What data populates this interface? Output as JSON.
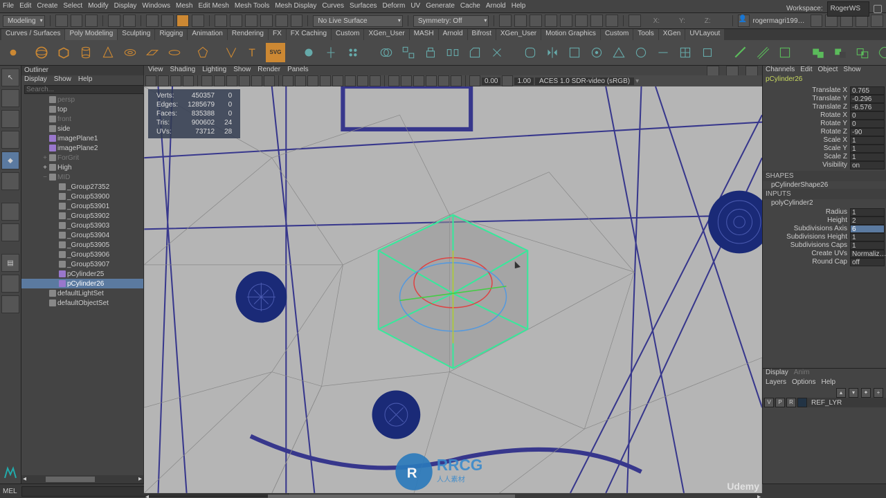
{
  "menu": [
    "File",
    "Edit",
    "Create",
    "Select",
    "Modify",
    "Display",
    "Windows",
    "Mesh",
    "Edit Mesh",
    "Mesh Tools",
    "Mesh Display",
    "Curves",
    "Surfaces",
    "Deform",
    "UV",
    "Generate",
    "Cache",
    "Arnold",
    "Help"
  ],
  "workspace": {
    "label": "Workspace:",
    "value": "RogerWS"
  },
  "modeDropdown": "Modeling",
  "statusbar": {
    "noLiveSurface": "No Live Surface",
    "symmetry": "Symmetry: Off",
    "user": "rogermagri199…"
  },
  "shelf": {
    "tabs": [
      "Curves / Surfaces",
      "Poly Modeling",
      "Sculpting",
      "Rigging",
      "Animation",
      "Rendering",
      "FX",
      "FX Caching",
      "Custom",
      "XGen_User",
      "MASH",
      "Arnold",
      "Bifrost",
      "XGen_User",
      "Motion Graphics",
      "Custom",
      "Tools",
      "XGen",
      "UVLayout"
    ],
    "active": 1
  },
  "outliner": {
    "title": "Outliner",
    "menu": [
      "Display",
      "Show",
      "Help"
    ],
    "searchPlaceholder": "Search...",
    "nodes": [
      {
        "label": "persp",
        "depth": 1,
        "ic": "cam",
        "dim": true
      },
      {
        "label": "top",
        "depth": 1,
        "ic": "cam"
      },
      {
        "label": "front",
        "depth": 1,
        "ic": "cam",
        "dim": true
      },
      {
        "label": "side",
        "depth": 1,
        "ic": "cam"
      },
      {
        "label": "imagePlane1",
        "depth": 1,
        "ic": "shape"
      },
      {
        "label": "imagePlane2",
        "depth": 1,
        "ic": "shape"
      },
      {
        "label": "ForGrit",
        "depth": 1,
        "ic": "grp",
        "dim": true,
        "tog": "+"
      },
      {
        "label": "High",
        "depth": 1,
        "ic": "grp",
        "tog": "+"
      },
      {
        "label": "MID",
        "depth": 1,
        "ic": "grp",
        "dim": true,
        "tog": "−"
      },
      {
        "label": "_Group27352",
        "depth": 2,
        "ic": "grp"
      },
      {
        "label": "_Group53900",
        "depth": 2,
        "ic": "grp"
      },
      {
        "label": "_Group53901",
        "depth": 2,
        "ic": "grp"
      },
      {
        "label": "_Group53902",
        "depth": 2,
        "ic": "grp"
      },
      {
        "label": "_Group53903",
        "depth": 2,
        "ic": "grp"
      },
      {
        "label": "_Group53904",
        "depth": 2,
        "ic": "grp"
      },
      {
        "label": "_Group53905",
        "depth": 2,
        "ic": "grp"
      },
      {
        "label": "_Group53906",
        "depth": 2,
        "ic": "grp"
      },
      {
        "label": "_Group53907",
        "depth": 2,
        "ic": "grp"
      },
      {
        "label": "pCylinder25",
        "depth": 2,
        "ic": "shape"
      },
      {
        "label": "pCylinder26",
        "depth": 2,
        "ic": "shape",
        "sel": true
      },
      {
        "label": "defaultLightSet",
        "depth": 1,
        "ic": "grp"
      },
      {
        "label": "defaultObjectSet",
        "depth": 1,
        "ic": "grp"
      }
    ]
  },
  "viewport": {
    "menu": [
      "View",
      "Shading",
      "Lighting",
      "Show",
      "Render",
      "Panels"
    ],
    "nums": {
      "a": "0.00",
      "b": "1.00"
    },
    "colorspace": "ACES 1.0 SDR-video (sRGB)",
    "hud": [
      [
        "Verts:",
        "450357",
        "0"
      ],
      [
        "Edges:",
        "1285679",
        "0"
      ],
      [
        "Faces:",
        "835388",
        "0"
      ],
      [
        "Tris:",
        "900602",
        "24"
      ],
      [
        "UVs:",
        "73712",
        "28"
      ]
    ]
  },
  "channelBox": {
    "menu": [
      "Channels",
      "Edit",
      "Object",
      "Show"
    ],
    "objName": "pCylinder26",
    "transform": [
      [
        "Translate X",
        "0.765"
      ],
      [
        "Translate Y",
        "-0.296"
      ],
      [
        "Translate Z",
        "-6.576"
      ],
      [
        "Rotate X",
        "0"
      ],
      [
        "Rotate Y",
        "0"
      ],
      [
        "Rotate Z",
        "-90"
      ],
      [
        "Scale X",
        "1"
      ],
      [
        "Scale Y",
        "1"
      ],
      [
        "Scale Z",
        "1"
      ],
      [
        "Visibility",
        "on"
      ]
    ],
    "sections": {
      "shapes": "SHAPES",
      "shape": "pCylinderShape26",
      "inputs": "INPUTS",
      "input": "polyCylinder2"
    },
    "inputAttrs": [
      [
        "Radius",
        "1"
      ],
      [
        "Height",
        "2"
      ],
      [
        "Subdivisions Axis",
        "6",
        true
      ],
      [
        "Subdivisions Height",
        "1"
      ],
      [
        "Subdivisions Caps",
        "1"
      ],
      [
        "Create UVs",
        "Normaliz…"
      ],
      [
        "Round Cap",
        "off"
      ]
    ]
  },
  "layers": {
    "tabs": [
      "Display",
      "Anim"
    ],
    "menu": [
      "Layers",
      "Options",
      "Help"
    ],
    "row": {
      "v": "V",
      "p": "P",
      "r": "R",
      "name": "REF_LYR"
    }
  },
  "cmd": {
    "label": "MEL"
  },
  "branding": "Udemy"
}
